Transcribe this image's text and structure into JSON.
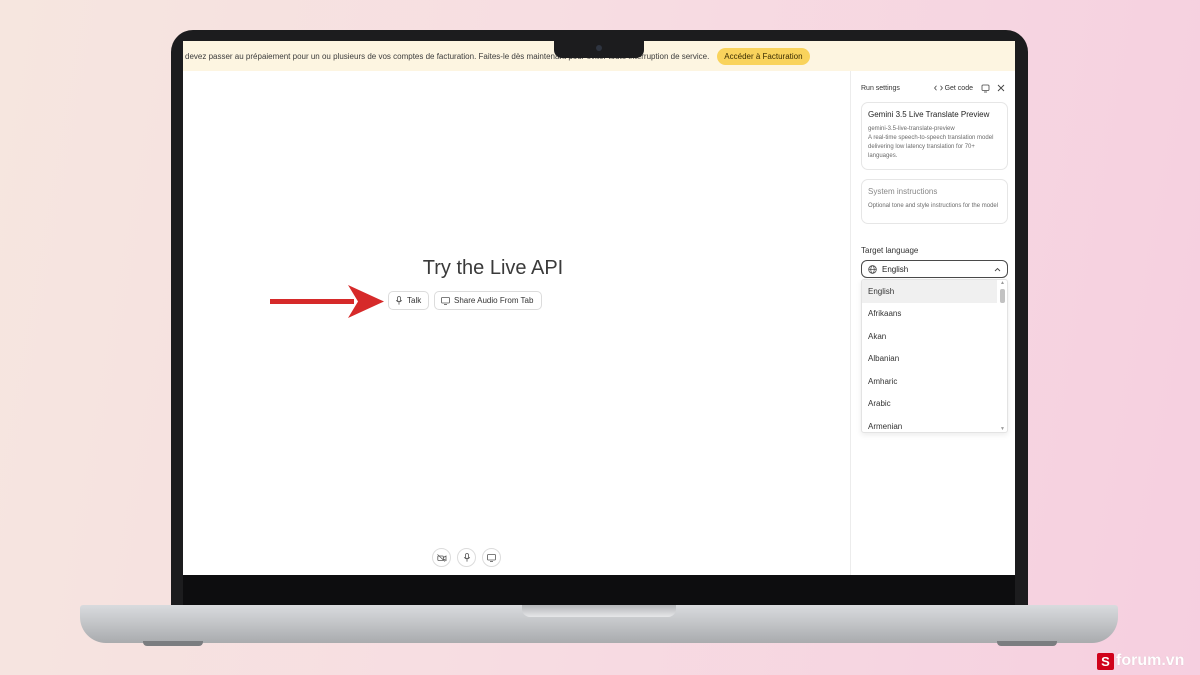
{
  "banner": {
    "text": "devez passer au prépaiement pour un ou plusieurs de vos comptes de facturation. Faites-le dès maintenant pour éviter toute interruption de service.",
    "button_label": "Accéder à Facturation"
  },
  "main": {
    "title": "Try the Live API",
    "talk_label": "Talk",
    "share_label": "Share Audio From Tab"
  },
  "panel": {
    "run_settings_label": "Run settings",
    "get_code_label": "Get code",
    "model": {
      "name": "Gemini 3.5 Live Translate Preview",
      "id": "gemini-3.5-live-translate-preview",
      "description": "A real-time speech-to-speech translation model delivering low latency translation for 70+ languages."
    },
    "system_instructions": {
      "title": "System instructions",
      "placeholder": "Optional tone and style instructions for the model"
    },
    "target_language": {
      "label": "Target language",
      "selected": "English",
      "options": [
        "English",
        "Afrikaans",
        "Akan",
        "Albanian",
        "Amharic",
        "Arabic",
        "Armenian"
      ]
    }
  },
  "watermark": {
    "logo_letter": "S",
    "text": "forum.vn"
  },
  "colors": {
    "banner_bg": "#fdf5e1",
    "banner_button": "#f9d35c",
    "arrow": "#d62a2a"
  }
}
